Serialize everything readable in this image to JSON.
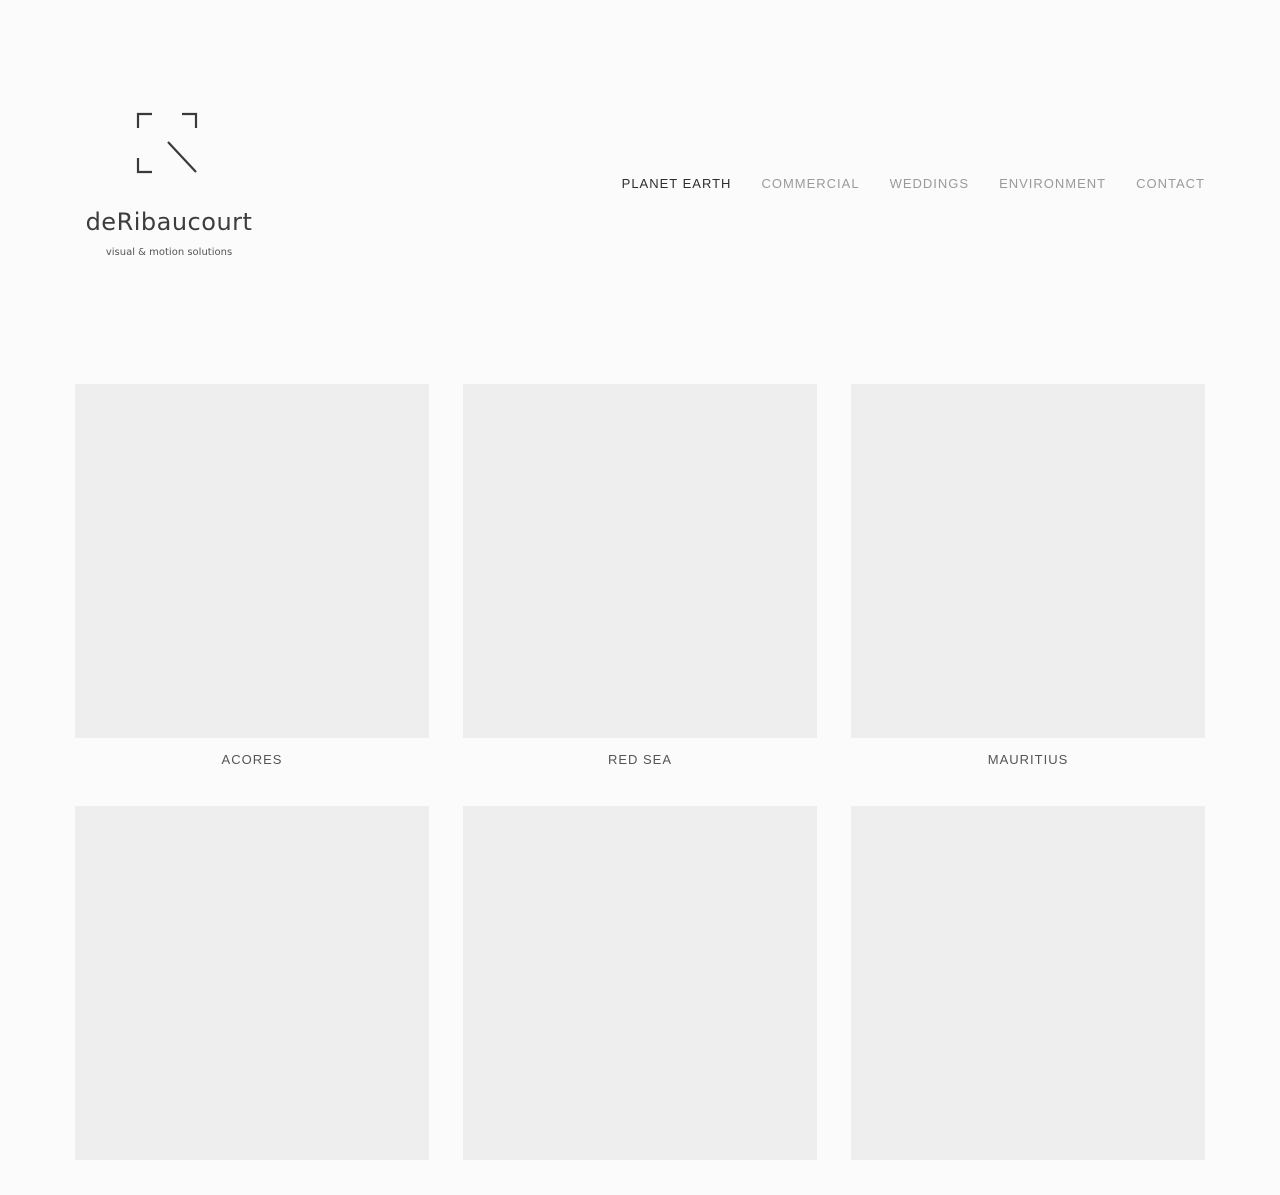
{
  "brand": {
    "name": "deRibaucourt",
    "tagline": "visual & motion solutions",
    "logo_icon": "corner-brackets-arrow-icon"
  },
  "nav": {
    "items": [
      {
        "label": "PLANET EARTH",
        "active": true
      },
      {
        "label": "COMMERCIAL",
        "active": false
      },
      {
        "label": "WEDDINGS",
        "active": false
      },
      {
        "label": "ENVIRONMENT",
        "active": false
      },
      {
        "label": "CONTACT",
        "active": false
      }
    ]
  },
  "gallery": {
    "items": [
      {
        "title": "ACORES"
      },
      {
        "title": "RED SEA"
      },
      {
        "title": "MAURITIUS"
      },
      {
        "title": ""
      },
      {
        "title": ""
      },
      {
        "title": ""
      }
    ]
  },
  "colors": {
    "background": "#fbfbfb",
    "placeholder": "#eeeeee",
    "nav_active": "#2f2f2f",
    "nav_inactive": "#9a9a9a"
  }
}
